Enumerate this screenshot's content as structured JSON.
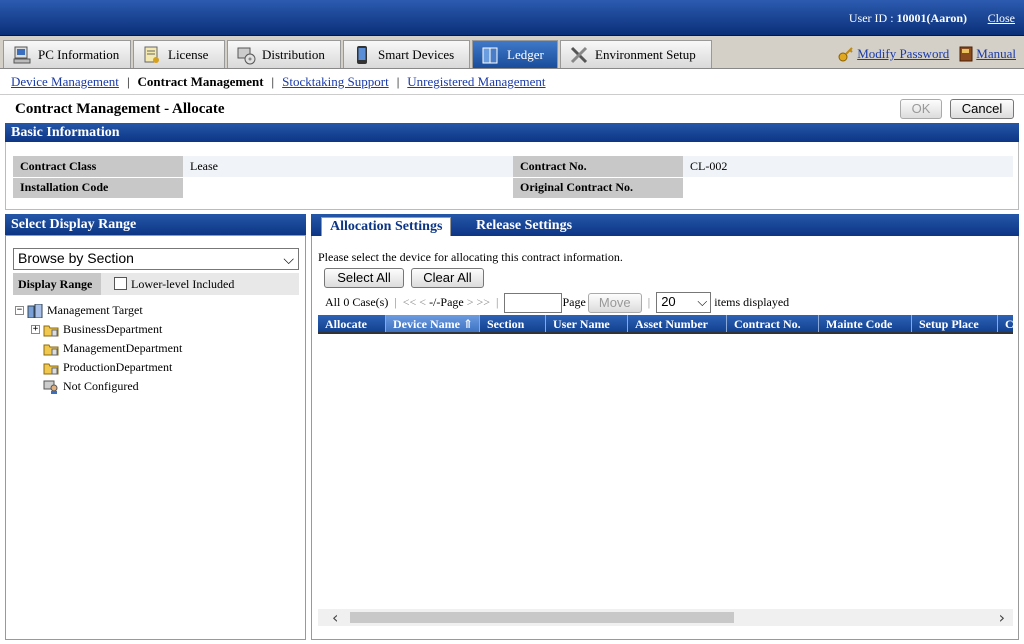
{
  "header": {
    "user_label": "User ID : ",
    "user_id": "10001(Aaron)",
    "close": "Close"
  },
  "tabs": [
    {
      "label": "PC Information",
      "icon": "pc-info-icon"
    },
    {
      "label": "License",
      "icon": "license-icon"
    },
    {
      "label": "Distribution",
      "icon": "distribution-icon"
    },
    {
      "label": "Smart Devices",
      "icon": "smart-device-icon"
    },
    {
      "label": "Ledger",
      "icon": "ledger-icon"
    },
    {
      "label": "Environment Setup",
      "icon": "tools-icon"
    }
  ],
  "top_links": {
    "modify_password": "Modify Password",
    "manual": "Manual"
  },
  "subnav": {
    "device_management": "Device Management",
    "contract_management": "Contract Management",
    "stocktaking_support": "Stocktaking Support",
    "unregistered_management": "Unregistered Management"
  },
  "page": {
    "title": "Contract Management - Allocate",
    "ok": "OK",
    "cancel": "Cancel"
  },
  "basic_info": {
    "header": "Basic Information",
    "contract_class_label": "Contract Class",
    "contract_class_value": "Lease",
    "contract_no_label": "Contract No.",
    "contract_no_value": "CL-002",
    "installation_code_label": "Installation Code",
    "installation_code_value": "",
    "original_contract_label": "Original Contract No.",
    "original_contract_value": ""
  },
  "display_range": {
    "header": "Select Display Range",
    "browse_value": "Browse by Section",
    "range_label": "Display Range",
    "lower_level": "Lower-level Included",
    "tree": [
      "Management Target",
      "BusinessDepartment",
      "ManagementDepartment",
      "ProductionDepartment",
      "Not Configured"
    ]
  },
  "allocation": {
    "tab_allocation": "Allocation Settings",
    "tab_release": "Release Settings",
    "instruction": "Please select the device for allocating this contract information.",
    "select_all": "Select All",
    "clear_all": "Clear All",
    "case_count": "All 0 Case(s)",
    "nav_first": "<<",
    "nav_prev": "<",
    "page_status": "-/-Page",
    "nav_next": ">",
    "nav_last": ">>",
    "page_label": "Page",
    "move": "Move",
    "items_value": "20",
    "items_label": "items displayed",
    "columns": [
      "Allocate",
      "Device Name",
      "Section",
      "User Name",
      "Asset Number",
      "Contract No.",
      "Mainte Code",
      "Setup Place",
      "C"
    ],
    "sort_indicator": "⇑"
  },
  "colors": {
    "header_blue": "#0d3585",
    "link": "#1a3aa8",
    "label_gray": "#c8c8c8"
  }
}
